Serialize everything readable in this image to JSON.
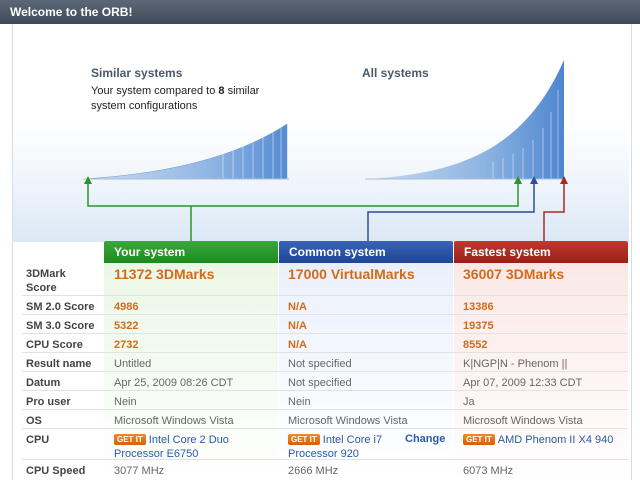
{
  "window": {
    "title": "Welcome to the ORB!"
  },
  "charts": {
    "similar": {
      "title": "Similar systems",
      "desc_prefix": "Your system compared to ",
      "count": "8",
      "desc_suffix": " similar system configurations"
    },
    "all": {
      "title": "All systems"
    }
  },
  "colors": {
    "your": "#2a962a",
    "common": "#2b4f9e",
    "fastest": "#a52a22",
    "accent": "#d46a1a"
  },
  "columns": {
    "your": "Your system",
    "common": "Common system",
    "fastest": "Fastest system"
  },
  "rows": [
    {
      "label": "3DMark Score",
      "your": "11372 3DMarks",
      "common": "17000 VirtualMarks",
      "fastest": "36007 3DMarks"
    },
    {
      "label": "SM 2.0 Score",
      "your": "4986",
      "common": "N/A",
      "fastest": "13386"
    },
    {
      "label": "SM 3.0 Score",
      "your": "5322",
      "common": "N/A",
      "fastest": "19375"
    },
    {
      "label": "CPU Score",
      "your": "2732",
      "common": "N/A",
      "fastest": "8552"
    },
    {
      "label": "Result name",
      "your": "Untitled",
      "common": "Not specified",
      "fastest": "K|NGP|N - Phenom ||"
    },
    {
      "label": "Datum",
      "your": "Apr 25, 2009 08:26 CDT",
      "common": "Not specified",
      "fastest": "Apr 07, 2009 12:33 CDT"
    },
    {
      "label": "Pro user",
      "your": "Nein",
      "common": "Nein",
      "fastest": "Ja"
    },
    {
      "label": "OS",
      "your": "Microsoft Windows Vista",
      "common": "Microsoft Windows Vista",
      "fastest": "Microsoft Windows Vista"
    },
    {
      "label": "CPU",
      "your": "Intel Core 2 Duo Processor E6750",
      "common": "Intel Core i7 Processor 920",
      "fastest": "AMD Phenom II X4 940"
    },
    {
      "label": "CPU Speed",
      "your": "3077 MHz",
      "common": "2666 MHz",
      "fastest": "6073 MHz"
    }
  ],
  "get_it_label": "GET IT",
  "change_label": "Change"
}
